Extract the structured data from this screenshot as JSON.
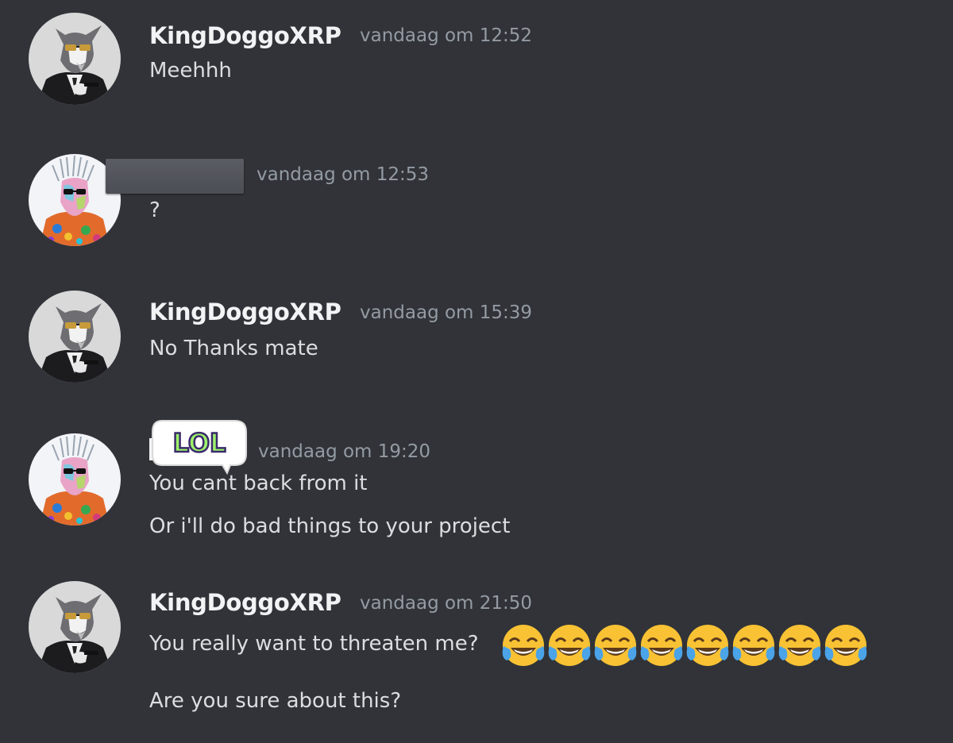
{
  "messages": [
    {
      "author": "KingDoggoXRP",
      "time": "vandaag om 12:52",
      "lines": [
        "Meehhh"
      ]
    },
    {
      "author": "",
      "time": "vandaag om 12:53",
      "lines": [
        "?"
      ]
    },
    {
      "author": "KingDoggoXRP",
      "time": "vandaag om 15:39",
      "lines": [
        "No Thanks mate"
      ]
    },
    {
      "author": "",
      "time": "vandaag om 19:20",
      "lines": [
        "You cant back from it",
        "Or i'll do bad things to your project"
      ]
    },
    {
      "author": "KingDoggoXRP",
      "time": "vandaag om 21:50",
      "lines": [
        "You really want to threaten me?",
        "Are you sure about this?"
      ]
    }
  ],
  "sticker": {
    "text": "LOL"
  },
  "emoji": {
    "name": "joy-emoji",
    "count": 8
  },
  "colors": {
    "background": "#313338",
    "username": "#f2f3f5",
    "timestamp": "#949ba4",
    "text": "#dbdee1"
  }
}
